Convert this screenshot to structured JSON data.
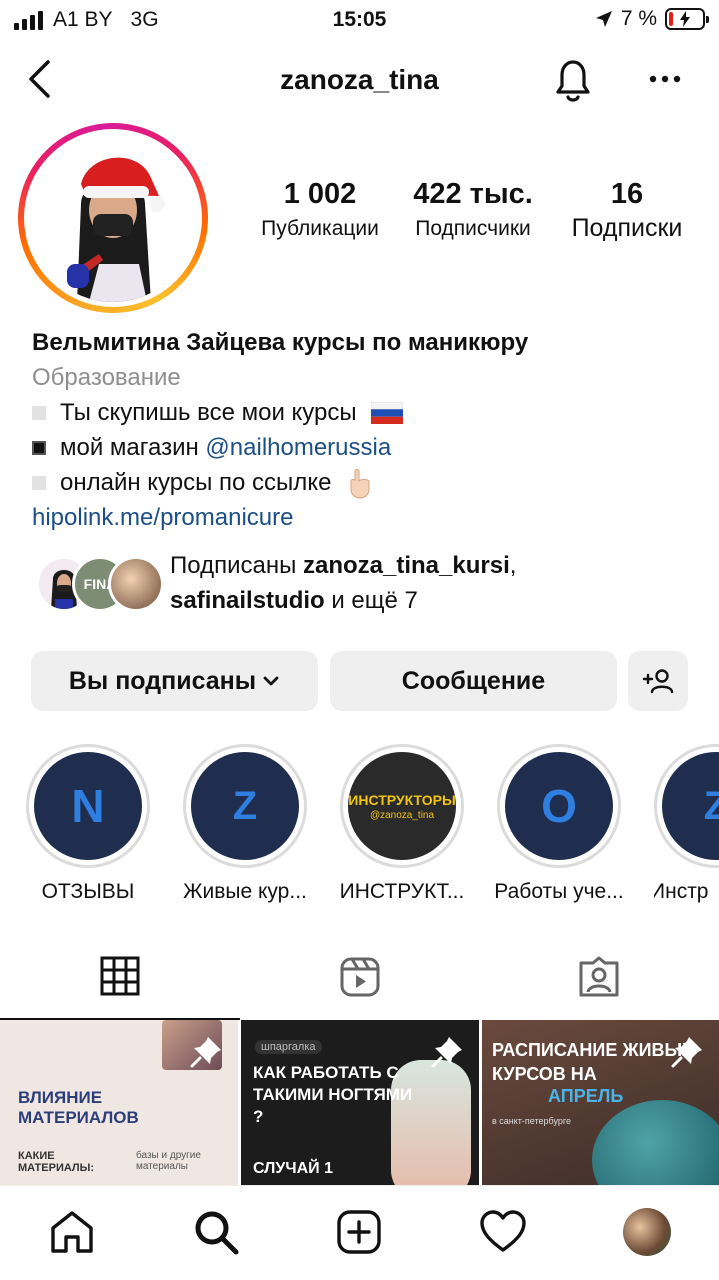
{
  "status": {
    "carrier": "A1 BY",
    "network": "3G",
    "time": "15:05",
    "battery": "7 %"
  },
  "header": {
    "username": "zanoza_tina"
  },
  "stats": [
    {
      "value": "1 002",
      "label": "Публикации"
    },
    {
      "value": "422 тыс.",
      "label": "Подписчики"
    },
    {
      "value": "16",
      "label": "Подписки"
    }
  ],
  "bio": {
    "name": "Вельмитина Зайцева курсы по маникюру",
    "category": "Образование",
    "line1": "Ты скупишь все мои курсы",
    "line2_prefix": "мой магазин",
    "line2_mention": "@nailhomerussia",
    "line3": "онлайн курсы по ссылке",
    "link": "hipolink.me/promanicure"
  },
  "followed": {
    "prefix": "Подписаны",
    "user1": "zanoza_tina_kursi",
    "user2": "safinailstudio",
    "and_more": "и ещё 7"
  },
  "buttons": {
    "following": "Вы подписаны",
    "message": "Сообщение"
  },
  "highlights": [
    {
      "label": "ОТЗЫВЫ",
      "letter": "N"
    },
    {
      "label": "Живые кур...",
      "letter": "Z"
    },
    {
      "label": "ИНСТРУКТ...",
      "cover_title": "ИНСТРУКТОРЫ",
      "cover_sub": "@zanoza_tina"
    },
    {
      "label": "Работы уче...",
      "letter": "O"
    },
    {
      "label": "Инстр",
      "letter": "Z"
    }
  ],
  "mini_avatar_text": "FINA",
  "posts": [
    {
      "title": "ВЛИЯНИЕ МАТЕРИАЛОВ",
      "sub_left": "КАКИЕ МАТЕРИАЛЫ:",
      "sub_right": "базы и другие материалы"
    },
    {
      "tag": "шпаргалка",
      "title": "КАК РАБОТАТЬ С ТАКИМИ НОГТЯМИ ?",
      "sub": "СЛУЧАЙ 1"
    },
    {
      "title1": "РАСПИСАНИЕ ЖИВЫХ КУРСОВ НА",
      "title2": "АПРЕЛЬ",
      "sub": "в санкт-петербурге"
    }
  ],
  "colors": {
    "link": "#1c4f87",
    "highlight_bg": "#1f2d4f",
    "highlight_letter": "#2f7fe0",
    "button_bg": "#efefef"
  }
}
